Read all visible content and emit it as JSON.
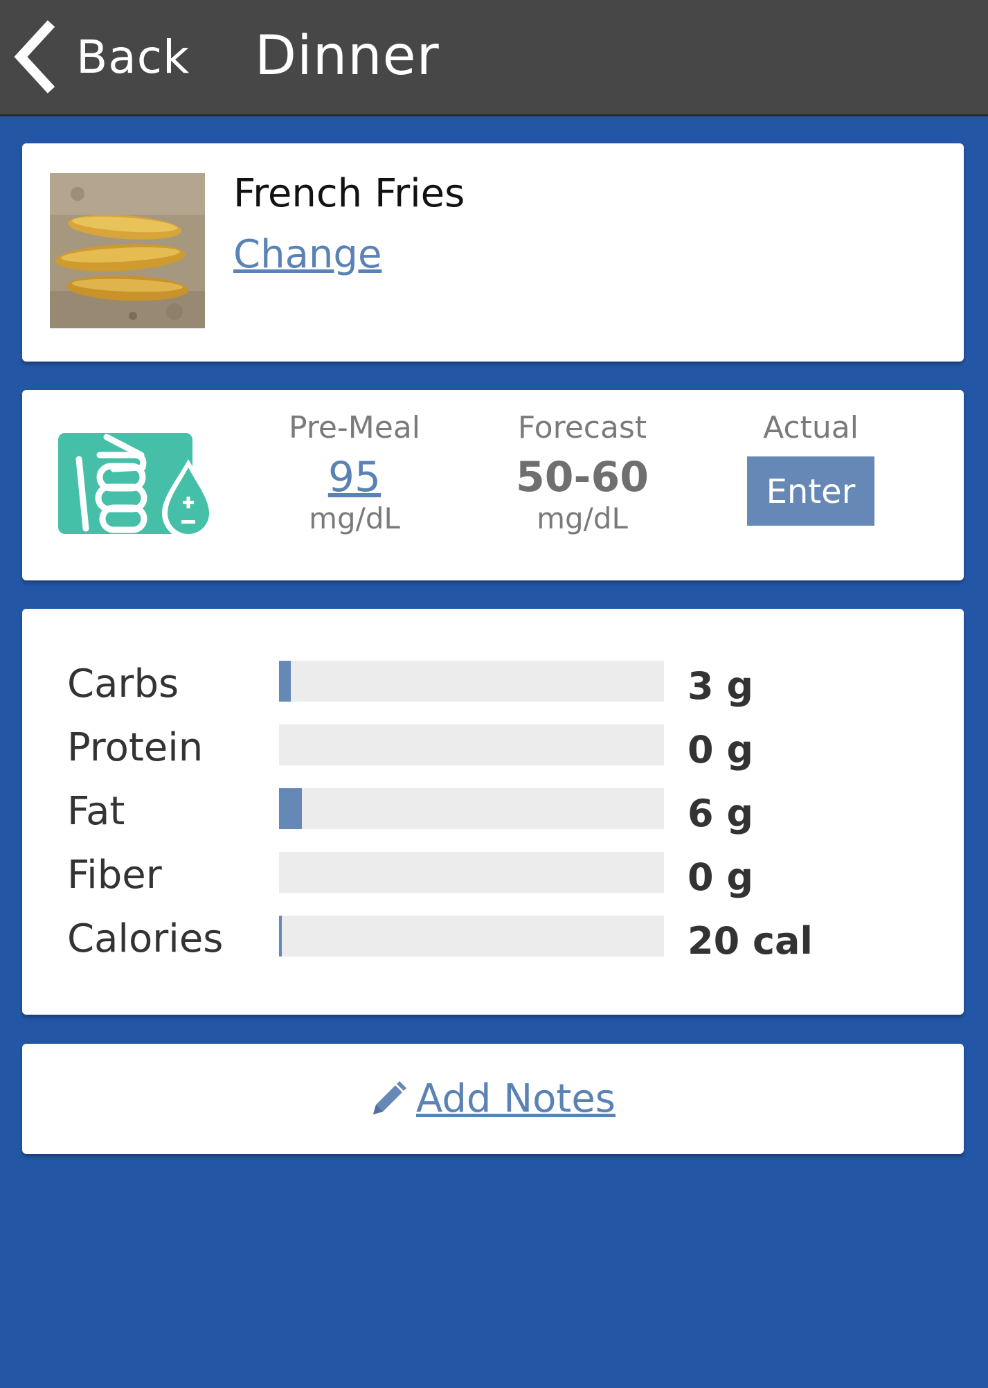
{
  "header": {
    "back_label": "Back",
    "title": "Dinner"
  },
  "food": {
    "name": "French Fries",
    "change_label": "Change",
    "photo_icon": "french-fries-photo"
  },
  "glucose": {
    "icon": "glucose-meter-icon",
    "pre_meal": {
      "label": "Pre-Meal",
      "value": "95",
      "unit": "mg/dL"
    },
    "forecast": {
      "label": "Forecast",
      "value": "50-60",
      "unit": "mg/dL"
    },
    "actual": {
      "label": "Actual",
      "button_label": "Enter"
    }
  },
  "nutrition": {
    "rows": [
      {
        "label": "Carbs",
        "value": "3 g",
        "fill_fraction": 0.03
      },
      {
        "label": "Protein",
        "value": "0 g",
        "fill_fraction": 0
      },
      {
        "label": "Fat",
        "value": "6 g",
        "fill_fraction": 0.06
      },
      {
        "label": "Fiber",
        "value": "0 g",
        "fill_fraction": 0
      },
      {
        "label": "Calories",
        "value": "20 cal",
        "fill_fraction": 0.008
      }
    ]
  },
  "notes": {
    "add_label": "Add Notes",
    "icon": "pencil-icon"
  },
  "colors": {
    "background": "#2356a4",
    "header": "#474747",
    "accent": "#6688b6",
    "link": "#5a82b5",
    "icon_teal": "#45bfa8"
  }
}
